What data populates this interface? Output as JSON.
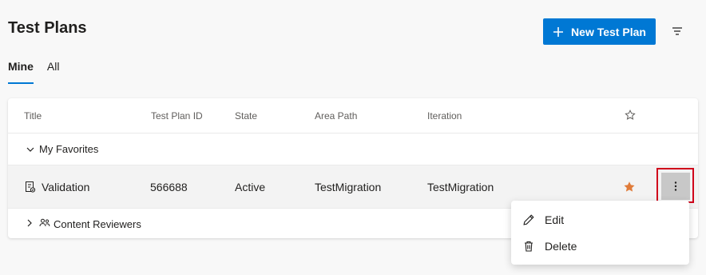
{
  "page": {
    "title": "Test Plans"
  },
  "toolbar": {
    "new_plan_label": "New Test Plan"
  },
  "tabs": [
    {
      "label": "Mine",
      "active": true
    },
    {
      "label": "All",
      "active": false
    }
  ],
  "table": {
    "columns": [
      "Title",
      "Test Plan ID",
      "State",
      "Area Path",
      "Iteration"
    ],
    "groups": [
      {
        "name": "My Favorites",
        "expanded": true,
        "rows": [
          {
            "title": "Validation",
            "id": "566688",
            "state": "Active",
            "area_path": "TestMigration",
            "iteration": "TestMigration",
            "favorite": true
          }
        ]
      },
      {
        "name": "Content Reviewers",
        "expanded": false,
        "rows": []
      }
    ]
  },
  "context_menu": {
    "items": [
      {
        "label": "Edit",
        "icon": "pencil-icon"
      },
      {
        "label": "Delete",
        "icon": "trash-icon"
      }
    ]
  },
  "colors": {
    "accent": "#0078d4",
    "favorite_star": "#e07b39",
    "highlight_outline": "#d0021b"
  }
}
